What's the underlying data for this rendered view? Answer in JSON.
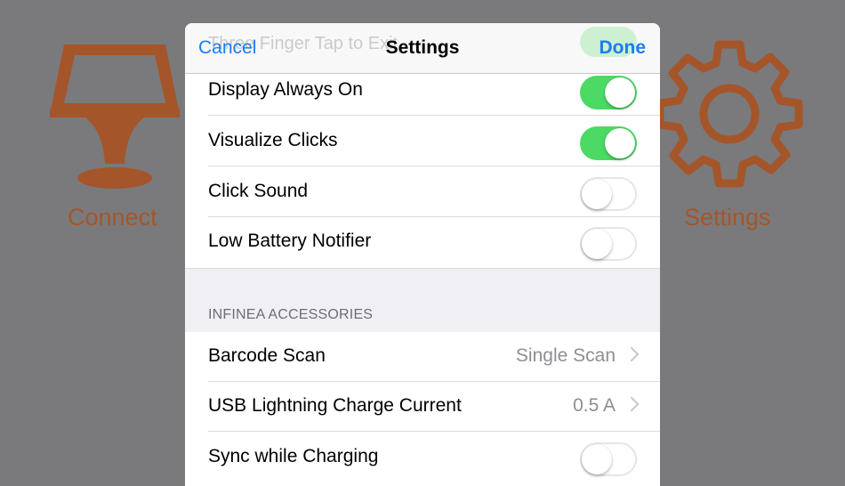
{
  "background": {
    "connect_label": "Connect",
    "settings_label": "Settings",
    "accent_color": "#a4562a"
  },
  "navbar": {
    "cancel_label": "Cancel",
    "title": "Settings",
    "done_label": "Done",
    "scrolled_row_label": "Three Finger Tap to Exit"
  },
  "rows": [
    {
      "label": "Display Always On",
      "toggle": true
    },
    {
      "label": "Visualize Clicks",
      "toggle": true
    },
    {
      "label": "Click Sound",
      "toggle": false
    },
    {
      "label": "Low Battery Notifier",
      "toggle": false
    }
  ],
  "accessories": {
    "header": "INFINEA ACCESSORIES",
    "rows": [
      {
        "label": "Barcode Scan",
        "value": "Single Scan"
      },
      {
        "label": "USB Lightning Charge Current",
        "value": "0.5 A"
      },
      {
        "label": "Sync while Charging",
        "toggle": false
      }
    ]
  },
  "colors": {
    "tint": "#1a7cf5",
    "toggle_on": "#4cd964"
  }
}
